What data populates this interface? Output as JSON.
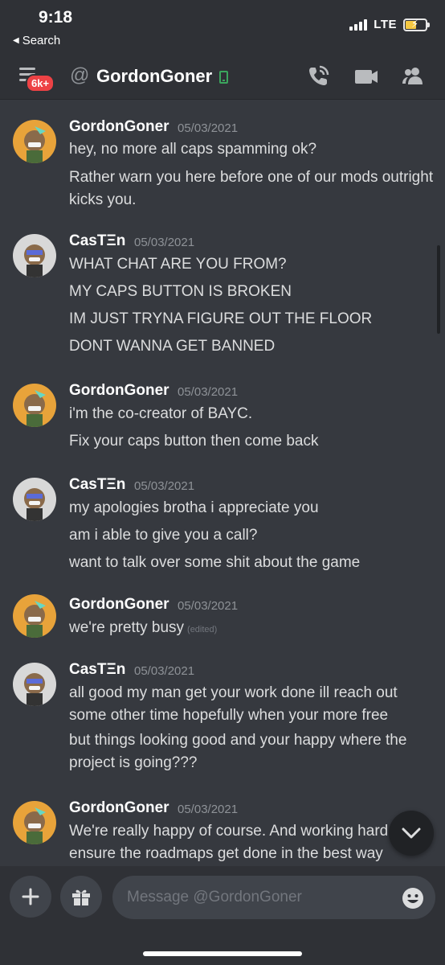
{
  "status_bar": {
    "time": "9:18",
    "back_label": "Search",
    "network": "LTE"
  },
  "header": {
    "unread_badge": "6k+",
    "at_symbol": "@",
    "channel_name": "GordonGoner"
  },
  "messages": [
    {
      "author": "GordonGoner",
      "timestamp": "05/03/2021",
      "lines": [
        "hey, no more all caps spamming ok?",
        "Rather warn you here before one of our mods outright kicks you."
      ]
    },
    {
      "author": "CasTΞn",
      "timestamp": "05/03/2021",
      "lines": [
        "WHAT CHAT ARE YOU FROM?",
        "MY CAPS BUTTON IS BROKEN",
        "IM JUST TRYNA FIGURE OUT THE FLOOR",
        "DONT WANNA GET BANNED"
      ]
    },
    {
      "author": "GordonGoner",
      "timestamp": "05/03/2021",
      "lines": [
        "i'm the co-creator of BAYC.",
        "Fix your caps button then come back"
      ]
    },
    {
      "author": "CasTΞn",
      "timestamp": "05/03/2021",
      "lines": [
        "my apologies brotha i appreciate you",
        "am i able to give you a call?",
        "want to talk over some shit about the game"
      ]
    },
    {
      "author": "GordonGoner",
      "timestamp": "05/03/2021",
      "lines": [
        "we're pretty busy"
      ],
      "edited_label": "(edited)"
    },
    {
      "author": "CasTΞn",
      "timestamp": "05/03/2021",
      "lines": [
        "all good my man get your work done ill reach out some other time hopefully when your more free",
        "but things looking good and your happy where the project is going???"
      ]
    },
    {
      "author": "GordonGoner",
      "timestamp": "05/03/2021",
      "lines": [
        "We're really happy of course. And working hard to ensure the roadmaps get done in the best way"
      ]
    }
  ],
  "composer": {
    "placeholder": "Message @GordonGoner"
  },
  "colors": {
    "background": "#36393f",
    "header": "#2f3136",
    "online_green": "#3ba55d",
    "badge_red": "#ed4245"
  },
  "icons": {
    "header": [
      "hamburger-menu-icon",
      "at-icon",
      "mobile-online-icon",
      "phone-call-icon",
      "video-camera-icon",
      "members-icon"
    ],
    "composer": [
      "plus-icon",
      "gift-icon",
      "emoji-icon"
    ],
    "floating": [
      "chevron-down-icon"
    ]
  }
}
